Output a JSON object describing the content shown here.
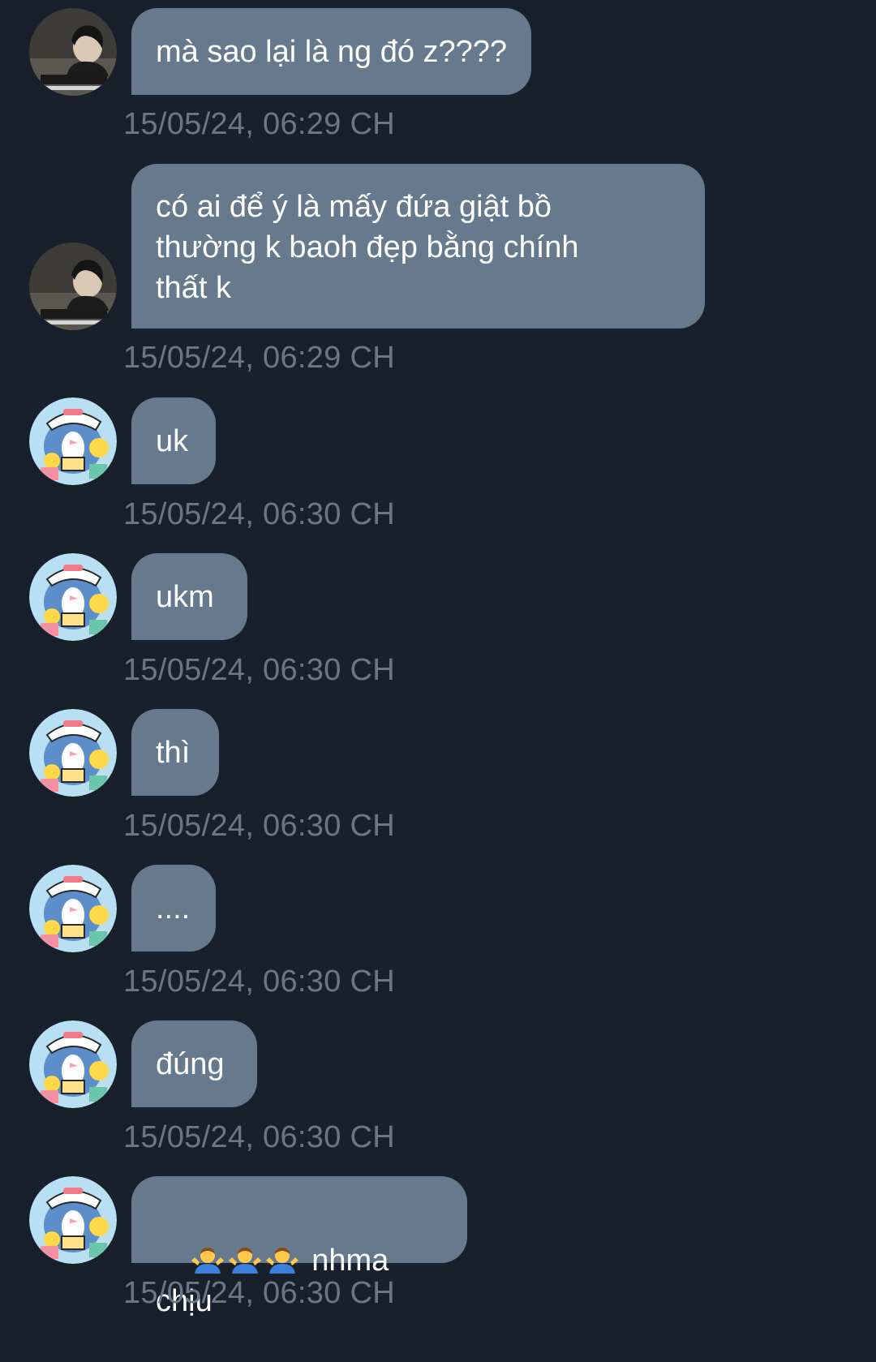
{
  "messages": [
    {
      "sender": "user1",
      "text": "mà sao lại là ng đó z????",
      "timestamp": "15/05/24, 06:29 CH"
    },
    {
      "sender": "user1",
      "text": "có ai để ý là mấy đứa giật bồ\nthường k baoh đẹp bằng chính\nthất k",
      "timestamp": "15/05/24, 06:29 CH"
    },
    {
      "sender": "user2",
      "text": "uk",
      "timestamp": "15/05/24, 06:30 CH"
    },
    {
      "sender": "user2",
      "text": "ukm",
      "timestamp": "15/05/24, 06:30 CH"
    },
    {
      "sender": "user2",
      "text": "thì",
      "timestamp": "15/05/24, 06:30 CH"
    },
    {
      "sender": "user2",
      "text": "....",
      "timestamp": "15/05/24, 06:30 CH"
    },
    {
      "sender": "user2",
      "text": "đúng",
      "timestamp": "15/05/24, 06:30 CH"
    },
    {
      "sender": "user2",
      "text": "nhma chịu",
      "emoji": "🤷‍♂️🤷‍♂️🤷‍♂️",
      "timestamp": "15/05/24, 06:30 CH"
    }
  ],
  "colors": {
    "background": "#18202b",
    "bubble": "#66798d",
    "bubble_text": "#ffffff",
    "timestamp": "#6b7787"
  },
  "avatars": {
    "user1": "person-photo-avatar",
    "user2": "cartoon-penguin-avatar"
  }
}
